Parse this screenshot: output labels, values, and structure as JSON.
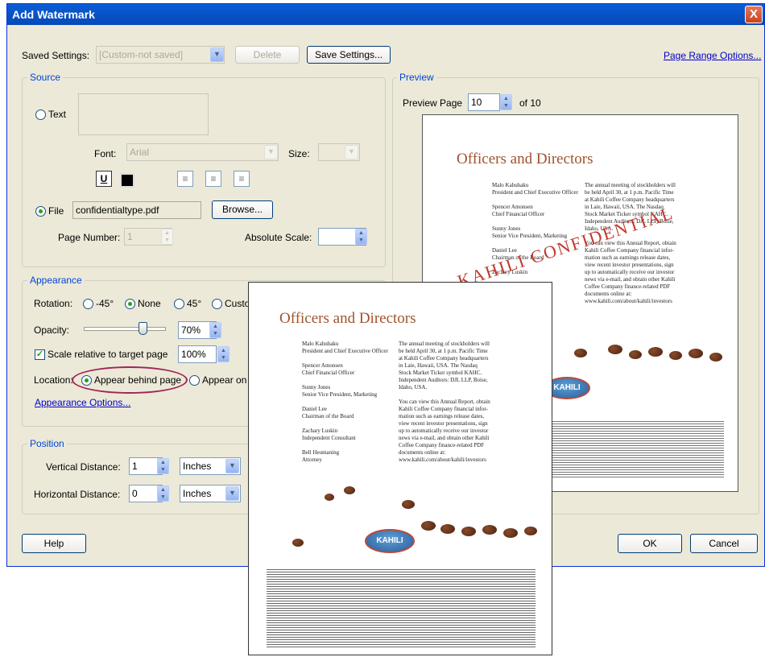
{
  "window": {
    "title": "Add Watermark",
    "close_glyph": "X"
  },
  "top": {
    "saved_settings_label": "Saved Settings:",
    "saved_settings_value": "[Custom-not saved]",
    "delete_label": "Delete",
    "save_settings_label": "Save Settings...",
    "page_range_label": "Page Range Options..."
  },
  "source": {
    "legend": "Source",
    "text_label": "Text",
    "font_label": "Font:",
    "font_value": "Arial",
    "size_label": "Size:",
    "underline_glyph": "U",
    "file_label": "File",
    "file_value": "confidentialtype.pdf",
    "browse_label": "Browse...",
    "page_number_label": "Page Number:",
    "page_number_value": "1",
    "absolute_scale_label": "Absolute Scale:"
  },
  "appearance": {
    "legend": "Appearance",
    "rotation_label": "Rotation:",
    "rot_m45": "-45°",
    "rot_none": "None",
    "rot_45": "45°",
    "rot_custom": "Custo",
    "opacity_label": "Opacity:",
    "opacity_value": "70%",
    "opacity_level": 0.7,
    "scale_label": "Scale relative to target page",
    "scale_value": "100%",
    "location_label": "Location:",
    "loc_behind": "Appear behind page",
    "loc_ontop": "Appear on",
    "options_link": "Appearance Options..."
  },
  "position": {
    "legend": "Position",
    "vertical_label": "Vertical Distance:",
    "vertical_value": "1",
    "vertical_unit": "Inches",
    "horizontal_label": "Horizontal Distance:",
    "horizontal_value": "0",
    "horizontal_unit": "Inches"
  },
  "preview": {
    "legend": "Preview",
    "page_label": "Preview Page",
    "page_value": "10",
    "of_label": "of 10"
  },
  "doc": {
    "title": "Officers and Directors",
    "watermark": "KAHILI CONFIDENTIAL",
    "logo": "KAHILI",
    "names": [
      "Malo Kahuhaku",
      "President and Chief Executive Officer",
      "Spencer Amonsen",
      "Chief Financial Officer",
      "Sunny Jones",
      "Senior Vice President, Marketing",
      "Daniel Lee",
      "Chairman of the Board",
      "Zachary Luskin",
      "Independent Consultant",
      "Bell Heumaning",
      "Attorney"
    ],
    "body": [
      "The annual meeting of stockholders will",
      "be held April 30, at 1 p.m. Pacific Time",
      "at Kahili Coffee Company headquarters",
      "in Laie, Hawaii, USA. The Nasdaq",
      "Stock Market Ticker symbol KAHC.",
      "Independent Auditors: DJL LLP, Boise,",
      "Idaho, USA.",
      "You can view this Annual Report, obtain",
      "Kahili Coffee Company financial infor-",
      "mation such as earnings release dates,",
      "view recent investor presentations, sign",
      "up to automatically receive our investor",
      "news via e-mail, and obtain other Kahili",
      "Coffee Company finance-related PDF",
      "documents online at:",
      "www.kahili.com/about/kahili/investors"
    ]
  },
  "buttons": {
    "help": "Help",
    "ok": "OK",
    "cancel": "Cancel"
  },
  "colors": {
    "title_bar": "#0854c8",
    "group_legend": "#0046d5",
    "callout": "#a0245a",
    "watermark": "#c0392b",
    "heading": "#a0522d"
  }
}
